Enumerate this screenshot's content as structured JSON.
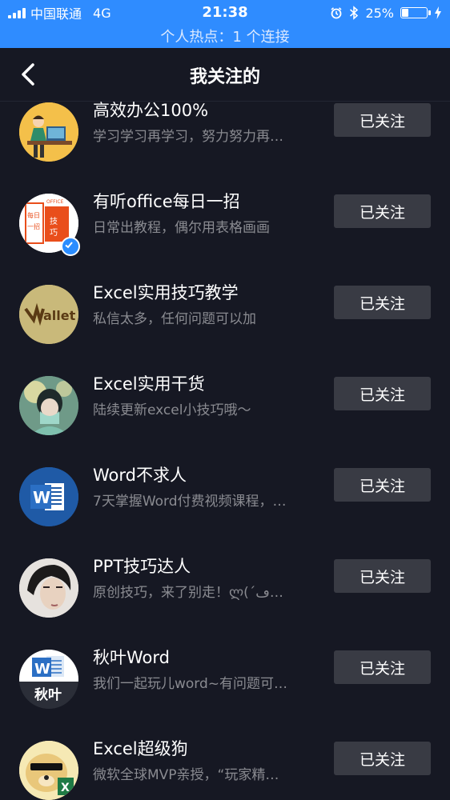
{
  "status_bar": {
    "carrier": "中国联通",
    "network": "4G",
    "time": "21:38",
    "battery": "25%",
    "battery_level": 0.25,
    "hotspot": "个人热点：1 个连接"
  },
  "nav": {
    "title": "我关注的"
  },
  "accounts": [
    {
      "name": "高效办公100%",
      "desc": "学习学习再学习，努力努力再…",
      "button": "已关注"
    },
    {
      "name": "有听office每日一招",
      "desc": "日常出教程，偶尔用表格画画",
      "button": "已关注",
      "avatar_text": "每日一招 技巧",
      "badge_text": "OFFICE"
    },
    {
      "name": "Excel实用技巧教学",
      "desc": "私信太多，任何问题可以加",
      "button": "已关注",
      "avatar_text": "allet"
    },
    {
      "name": "Excel实用干货",
      "desc": "陆续更新excel小技巧哦～",
      "button": "已关注"
    },
    {
      "name": "Word不求人",
      "desc": "7天掌握Word付费视频课程，…",
      "button": "已关注",
      "avatar_text": "W"
    },
    {
      "name": "PPT技巧达人",
      "desc": "原创技巧，来了别走！ლ(´ڡ…",
      "button": "已关注"
    },
    {
      "name": "秋叶Word",
      "desc": "我们一起玩儿word~有问题可…",
      "button": "已关注",
      "avatar_text": "W",
      "avatar_caption": "秋叶"
    },
    {
      "name": "Excel超级狗",
      "desc": "微软全球MVP亲授，“玩家精…",
      "button": "已关注",
      "avatar_text": "X"
    }
  ],
  "colors": {
    "background": "#161823",
    "status_bar": "#2f8cff",
    "button": "#393b44",
    "secondary_text": "#8a8b91"
  }
}
